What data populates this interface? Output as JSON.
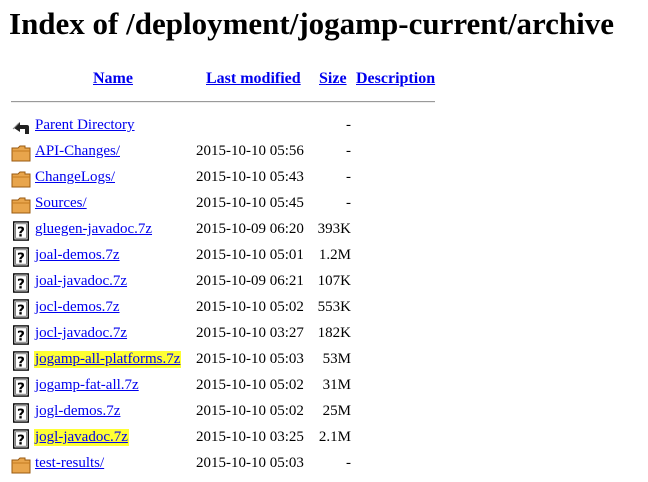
{
  "title": "Index of /deployment/jogamp-current/archive",
  "columns": {
    "name": "Name",
    "last_modified": "Last modified",
    "size": "Size",
    "description": "Description"
  },
  "entries": [
    {
      "icon": "back-icon",
      "name": "Parent Directory",
      "modified": "",
      "size": "-",
      "highlight": false
    },
    {
      "icon": "folder-icon",
      "name": "API-Changes/",
      "modified": "2015-10-10 05:56",
      "size": "-",
      "highlight": false
    },
    {
      "icon": "folder-icon",
      "name": "ChangeLogs/",
      "modified": "2015-10-10 05:43",
      "size": "-",
      "highlight": false
    },
    {
      "icon": "folder-icon",
      "name": "Sources/",
      "modified": "2015-10-10 05:45",
      "size": "-",
      "highlight": false
    },
    {
      "icon": "unknown-file-icon",
      "name": "gluegen-javadoc.7z",
      "modified": "2015-10-09 06:20",
      "size": "393K",
      "highlight": false
    },
    {
      "icon": "unknown-file-icon",
      "name": "joal-demos.7z",
      "modified": "2015-10-10 05:01",
      "size": "1.2M",
      "highlight": false
    },
    {
      "icon": "unknown-file-icon",
      "name": "joal-javadoc.7z",
      "modified": "2015-10-09 06:21",
      "size": "107K",
      "highlight": false
    },
    {
      "icon": "unknown-file-icon",
      "name": "jocl-demos.7z",
      "modified": "2015-10-10 05:02",
      "size": "553K",
      "highlight": false
    },
    {
      "icon": "unknown-file-icon",
      "name": "jocl-javadoc.7z",
      "modified": "2015-10-10 03:27",
      "size": "182K",
      "highlight": false
    },
    {
      "icon": "unknown-file-icon",
      "name": "jogamp-all-platforms.7z",
      "modified": "2015-10-10 05:03",
      "size": "53M",
      "highlight": true,
      "highlight_color": "#ffff33"
    },
    {
      "icon": "unknown-file-icon",
      "name": "jogamp-fat-all.7z",
      "modified": "2015-10-10 05:02",
      "size": "31M",
      "highlight": false
    },
    {
      "icon": "unknown-file-icon",
      "name": "jogl-demos.7z",
      "modified": "2015-10-10 05:02",
      "size": "25M",
      "highlight": false
    },
    {
      "icon": "unknown-file-icon",
      "name": "jogl-javadoc.7z",
      "modified": "2015-10-10 03:25",
      "size": "2.1M",
      "highlight": true,
      "highlight_color": "#ffff33"
    },
    {
      "icon": "folder-icon",
      "name": "test-results/",
      "modified": "2015-10-10 05:03",
      "size": "-",
      "highlight": false
    }
  ],
  "colors": {
    "link": "#0000ee",
    "folder": "#e8a54c",
    "highlight": "#ffff33"
  }
}
